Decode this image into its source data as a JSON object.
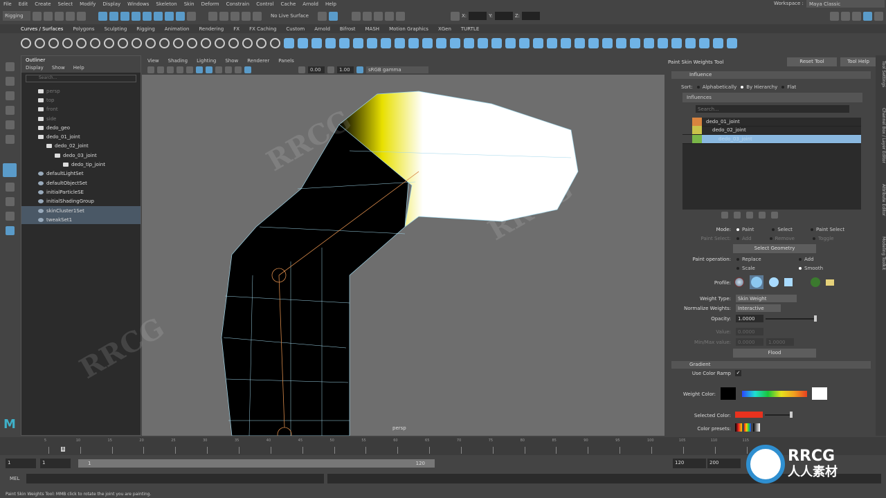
{
  "menubar": [
    "File",
    "Edit",
    "Create",
    "Select",
    "Modify",
    "Display",
    "Windows",
    "Skeleton",
    "Skin",
    "Deform",
    "Constrain",
    "Control",
    "Cache",
    "Arnold",
    "Help"
  ],
  "statusline": {
    "mode": "Rigging",
    "live_surface": "No Live Surface",
    "x_label": "X:",
    "y_label": "Y:",
    "z_label": "Z:",
    "workspace_label": "Workspace :",
    "workspace": "Maya Classic"
  },
  "shelf_tabs": [
    "Curves / Surfaces",
    "Polygons",
    "Sculpting",
    "Rigging",
    "Animation",
    "Rendering",
    "FX",
    "FX Caching",
    "Custom",
    "Arnold",
    "Bifrost",
    "MASH",
    "Motion Graphics",
    "XGen",
    "TURTLE"
  ],
  "outliner": {
    "title": "Outliner",
    "menu": [
      "Display",
      "Show",
      "Help"
    ],
    "search_placeholder": "Search...",
    "items": [
      {
        "label": "persp",
        "indent": 0,
        "dim": true,
        "icon": "camera-icon"
      },
      {
        "label": "top",
        "indent": 0,
        "dim": true,
        "icon": "camera-icon"
      },
      {
        "label": "front",
        "indent": 0,
        "dim": true,
        "icon": "camera-icon"
      },
      {
        "label": "side",
        "indent": 0,
        "dim": true,
        "icon": "camera-icon"
      },
      {
        "label": "dedo_geo",
        "indent": 0,
        "icon": "mesh-icon"
      },
      {
        "label": "dedo_01_joint",
        "indent": 0,
        "icon": "joint-icon"
      },
      {
        "label": "dedo_02_joint",
        "indent": 1,
        "icon": "joint-icon"
      },
      {
        "label": "dedo_03_joint",
        "indent": 2,
        "icon": "joint-icon"
      },
      {
        "label": "dedo_tip_joint",
        "indent": 3,
        "icon": "joint-icon"
      },
      {
        "label": "defaultLightSet",
        "indent": 0,
        "icon": "set-icon"
      },
      {
        "label": "defaultObjectSet",
        "indent": 0,
        "icon": "set-icon"
      },
      {
        "label": "initialParticleSE",
        "indent": 0,
        "icon": "set-icon"
      },
      {
        "label": "initialShadingGroup",
        "indent": 0,
        "icon": "set-icon"
      },
      {
        "label": "skinCluster1Set",
        "indent": 0,
        "icon": "set-icon",
        "selected": true
      },
      {
        "label": "tweakSet1",
        "indent": 0,
        "icon": "set-icon",
        "selected": true
      }
    ]
  },
  "viewport": {
    "menu": [
      "View",
      "Shading",
      "Lighting",
      "Show",
      "Renderer",
      "Panels"
    ],
    "exposure": "0.00",
    "gamma": "1.00",
    "color_space": "sRGB gamma",
    "camera": "persp"
  },
  "tool": {
    "title": "Paint Skin Weights Tool",
    "reset": "Reset Tool",
    "help": "Tool Help",
    "influence_section": "Influence",
    "sort_label": "Sort:",
    "sort_options": [
      "Alphabetically",
      "By Hierarchy",
      "Flat"
    ],
    "sort_selected": "By Hierarchy",
    "influences_header": "Influences",
    "search_placeholder": "Search...",
    "influences": [
      {
        "label": "dedo_01_joint",
        "color": "#d9843f"
      },
      {
        "label": "dedo_02_joint",
        "color": "#c9c24a"
      },
      {
        "label": "dedo_03_joint",
        "color": "#7ab648",
        "selected": true
      }
    ],
    "mode_label": "Mode:",
    "modes": [
      "Paint",
      "Select",
      "Paint Select"
    ],
    "paint_select_label": "Paint Select:",
    "paint_select": [
      "Add",
      "Remove",
      "Toggle"
    ],
    "select_geometry": "Select Geometry",
    "paint_op_label": "Paint operation:",
    "paint_ops": [
      "Replace",
      "Add",
      "Scale",
      "Smooth"
    ],
    "paint_op_selected": "Smooth",
    "profile_label": "Profile:",
    "weight_type_label": "Weight Type:",
    "weight_type": "Skin Weight",
    "normalize_label": "Normalize Weights:",
    "normalize": "Interactive",
    "opacity_label": "Opacity:",
    "opacity": "1.0000",
    "opacity_level": 1.0,
    "value_label": "Value:",
    "value": "0.0000",
    "minmax_label": "Min/Max value:",
    "min": "0.0000",
    "max": "1.0000",
    "flood": "Flood",
    "gradient_section": "Gradient",
    "use_color_ramp": "Use Color Ramp",
    "use_color_ramp_checked": true,
    "weight_color_label": "Weight Color:",
    "selected_color_label": "Selected Color:",
    "selected_color": "#e8321e",
    "color_presets_label": "Color presets:"
  },
  "side_tabs": [
    "Tool Settings",
    "Channel Box / Layer Editor",
    "Attribute Editor",
    "Modeling Toolkit"
  ],
  "timeline": {
    "ticks": [
      "5",
      "10",
      "15",
      "20",
      "25",
      "30",
      "35",
      "40",
      "45",
      "50",
      "55",
      "60",
      "65",
      "70",
      "75",
      "80",
      "85",
      "90",
      "95",
      "100",
      "105",
      "110",
      "115"
    ],
    "current": "8"
  },
  "range": {
    "start": "1",
    "current_start": "1",
    "slider_start": "1",
    "slider_end": "120",
    "end": "120",
    "max": "200"
  },
  "command": {
    "label": "MEL"
  },
  "help_line": "Paint Skin Weights Tool: MMB click to rotate the joint you are painting.",
  "watermark": "RRCG 人人素材"
}
